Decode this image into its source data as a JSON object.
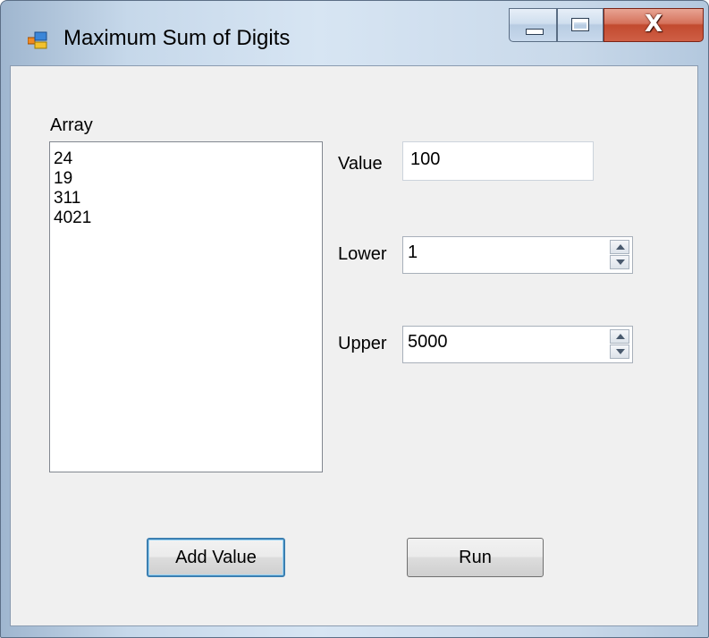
{
  "window": {
    "title": "Maximum Sum of Digits",
    "icon": "app-window-icon",
    "caption_buttons": {
      "minimize_icon": "minimize-icon",
      "maximize_icon": "maximize-icon",
      "close_label": "X"
    }
  },
  "form": {
    "array_label": "Array",
    "array_items": [
      "24",
      "19",
      "311",
      "4021"
    ],
    "value_label": "Value",
    "value_input": "100",
    "lower_label": "Lower",
    "lower_value": "1",
    "upper_label": "Upper",
    "upper_value": "5000",
    "add_button_label": "Add Value",
    "run_button_label": "Run"
  }
}
